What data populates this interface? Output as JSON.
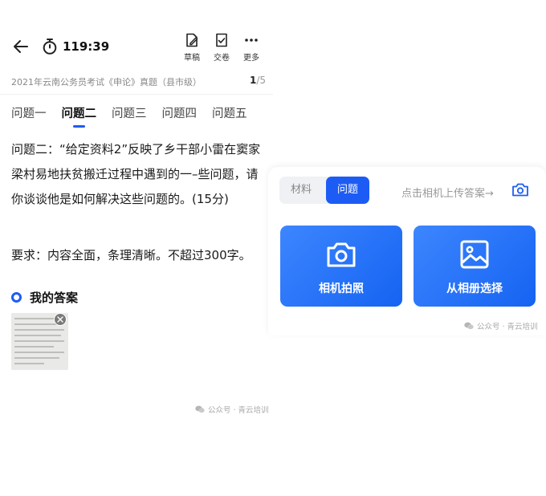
{
  "header": {
    "timer": "119:39",
    "tools": {
      "draft": "草稿",
      "submit": "交卷",
      "more": "更多"
    }
  },
  "exam": {
    "title": "2021年云南公务员考试《申论》真题（县市级）",
    "page_current": "1",
    "page_total": "/5"
  },
  "tabs": [
    {
      "label": "问题一",
      "active": false
    },
    {
      "label": "问题二",
      "active": true
    },
    {
      "label": "问题三",
      "active": false
    },
    {
      "label": "问题四",
      "active": false
    },
    {
      "label": "问题五",
      "active": false
    }
  ],
  "question": {
    "text": "问题二：“给定资料2”反映了乡干部小雷在窦家梁村易地扶贫搬迁过程中遇到的一–些问题，请你谈谈他是如何解决这些问题的。(15分)",
    "requirement": "要求：内容全面，条理清晰。不超过300字。"
  },
  "answer": {
    "title": "我的答案"
  },
  "watermark": "公众号 · 青云培训",
  "upload_panel": {
    "segments": {
      "material": "材料",
      "question": "问题"
    },
    "hint": "点击相机上传答案→",
    "camera_button": "相机拍照",
    "album_button": "从相册选择"
  },
  "colors": {
    "accent": "#1d5cf4",
    "button_gradient_start": "#3d86ff",
    "button_gradient_end": "#1563f2"
  }
}
